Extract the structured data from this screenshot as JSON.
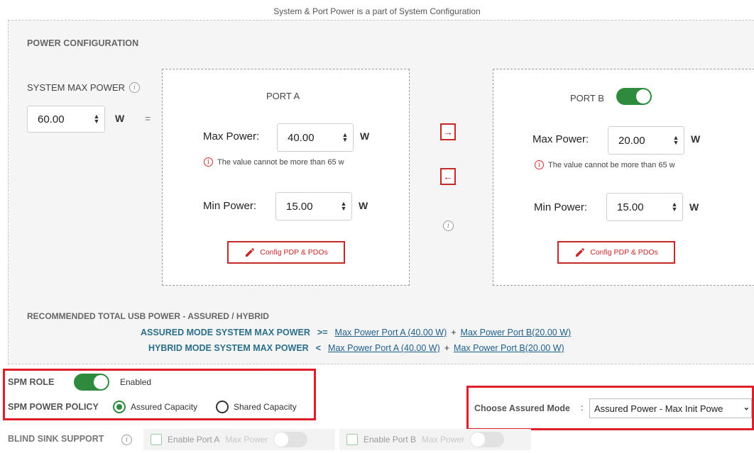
{
  "top_note": "System & Port Power is a part of System Configuration",
  "section_title": "POWER CONFIGURATION",
  "system": {
    "label": "SYSTEM MAX POWER",
    "value": "60.00",
    "unit": "W",
    "equals": "="
  },
  "port_a": {
    "title": "PORT A",
    "max_label": "Max Power:",
    "max_value": "40.00",
    "min_label": "Min Power:",
    "min_value": "15.00",
    "unit": "W",
    "warning": "The value cannot be more than 65 w",
    "config_button": "Config PDP & PDOs"
  },
  "port_b": {
    "title": "PORT B",
    "enabled": true,
    "max_label": "Max Power:",
    "max_value": "20.00",
    "min_label": "Min Power:",
    "min_value": "15.00",
    "unit": "W",
    "warning": "The value cannot be more than 65 w",
    "config_button": "Config PDP & PDOs"
  },
  "transfer": {
    "right_arrow": "→",
    "left_arrow": "←"
  },
  "recommended": {
    "title": "RECOMMENDED TOTAL USB POWER - ASSURED / HYBRID",
    "assured": {
      "label": "ASSURED MODE SYSTEM MAX POWER",
      "op": ">=",
      "link_a": "Max Power Port A (40.00 W)",
      "plus": "+",
      "link_b": "Max Power Port B(20.00 W)"
    },
    "hybrid": {
      "label": "HYBRID MODE SYSTEM MAX POWER",
      "op": "<",
      "link_a": "Max Power Port A (40.00 W)",
      "plus": "+",
      "link_b": "Max Power Port B(20.00 W)"
    }
  },
  "spm": {
    "role_label": "SPM ROLE",
    "role_state": "Enabled",
    "policy_label": "SPM POWER POLICY",
    "option_assured": "Assured Capacity",
    "option_shared": "Shared Capacity",
    "selected": "Assured Capacity"
  },
  "assured_mode": {
    "label": "Choose Assured Mode",
    "colon": ":",
    "value": "Assured Power - Max Init Powe"
  },
  "blind_sink": {
    "label": "BLIND SINK SUPPORT",
    "port_a_label": "Enable Port A",
    "port_b_label": "Enable Port B",
    "max_power_label": "Max Power"
  },
  "colors": {
    "accent_red": "#c62828",
    "toggle_green": "#2e8b3d",
    "link_blue": "#1f5f8b",
    "highlight_frame": "#e01e2b"
  }
}
